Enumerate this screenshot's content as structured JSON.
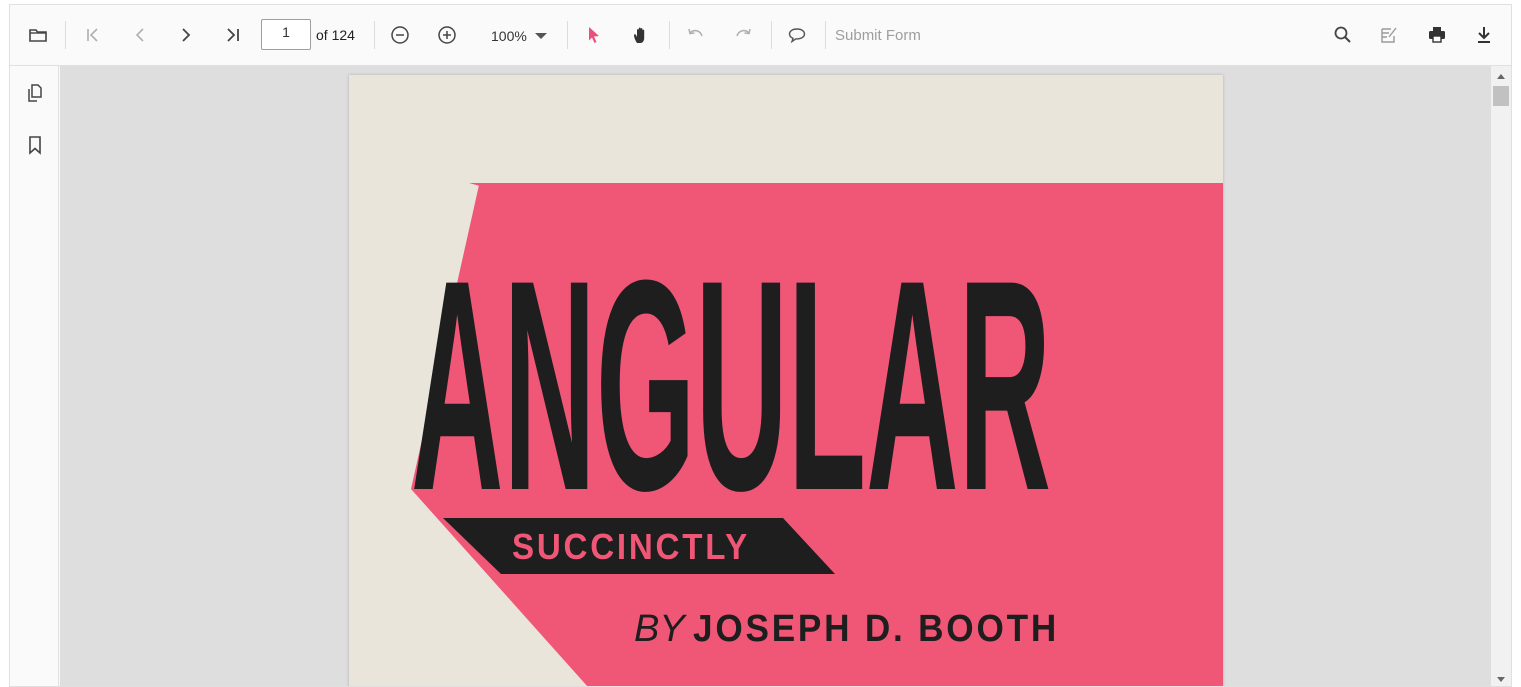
{
  "toolbar": {
    "current_page": "1",
    "page_count_label": "of 124",
    "zoom_value": "100%",
    "submit_form_label": "Submit Form",
    "icons": {
      "open": "folder-open-icon",
      "first": "first-page-icon",
      "previous": "previous-page-icon",
      "next": "next-page-icon",
      "last": "last-page-icon",
      "zoom_out": "zoom-out-icon",
      "zoom_in": "zoom-in-icon",
      "selection": "text-selection-cursor-icon",
      "pan": "pan-hand-icon",
      "undo": "undo-icon",
      "redo": "redo-icon",
      "comment": "comment-icon",
      "search": "search-icon",
      "annotation": "annotation-edit-icon",
      "print": "print-icon",
      "download": "download-icon"
    }
  },
  "sidebar": {
    "icons": [
      "page-thumbnails-icon",
      "bookmark-icon"
    ]
  },
  "document": {
    "cover_title": "ANGULAR",
    "cover_subtitle": "SUCCINCTLY",
    "cover_by": "BY",
    "cover_author": "JOSEPH D. BOOTH"
  },
  "colors": {
    "accent": "#e8527a",
    "cover_background": "#e9e5db",
    "cover_pink": "#f05777",
    "cover_black": "#1e1e1e",
    "viewer_background": "#dedede"
  }
}
